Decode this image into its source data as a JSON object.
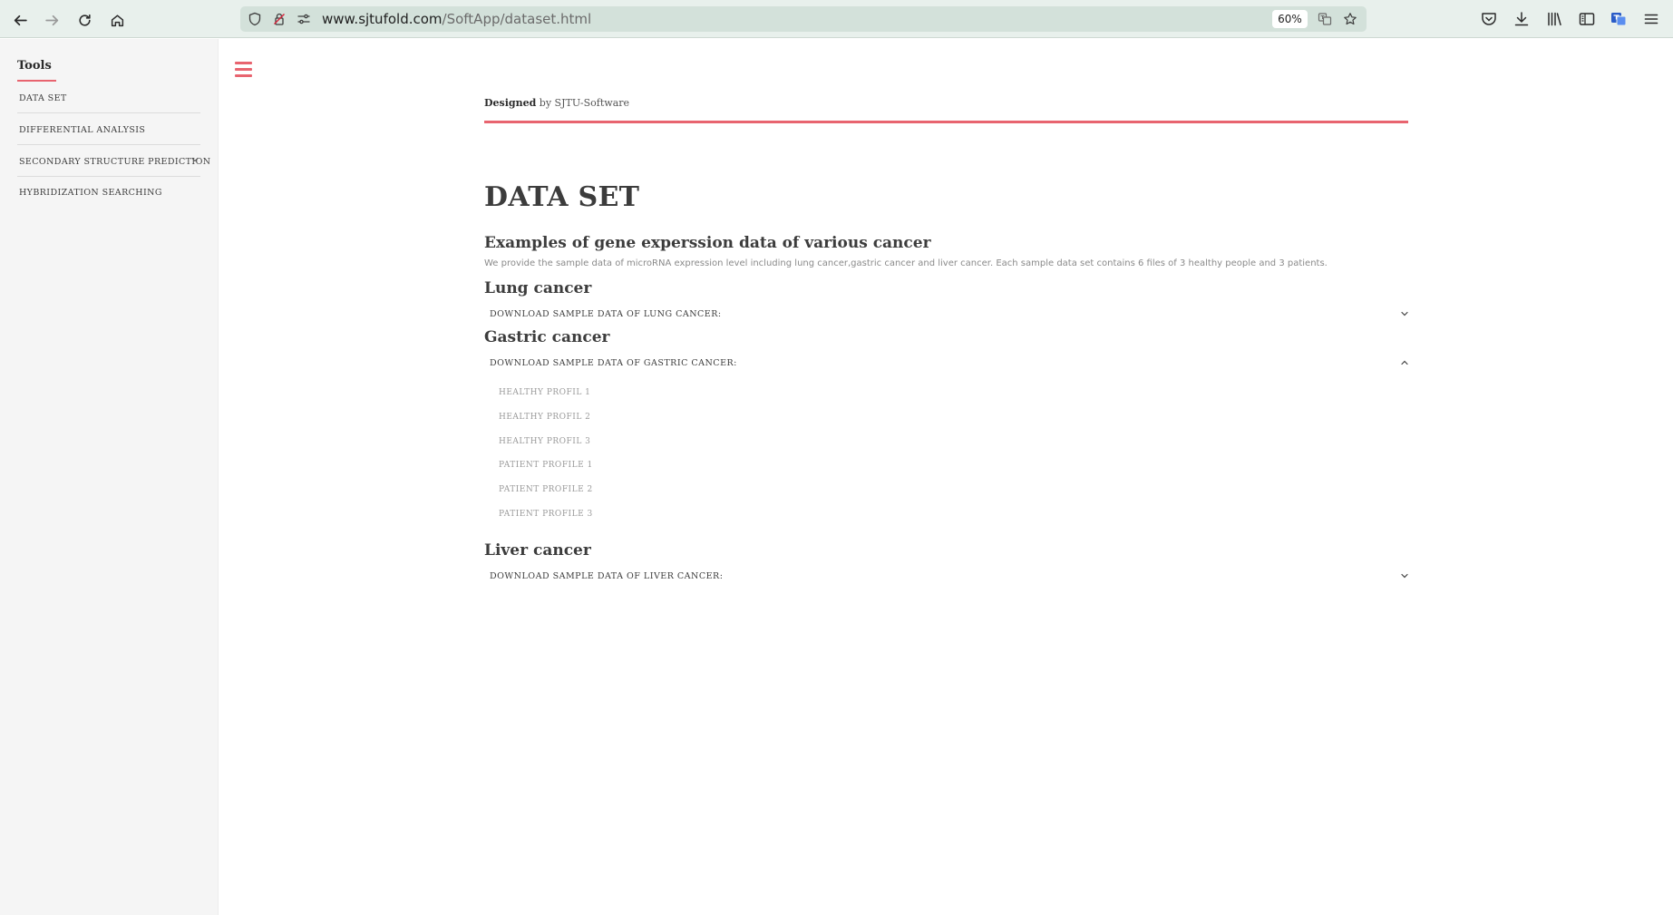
{
  "browser": {
    "url_host": "www.sjtufold.com",
    "url_path": "/SoftApp/dataset.html",
    "zoom": "60%"
  },
  "sidebar": {
    "title": "Tools",
    "items": [
      {
        "label": "DATA SET"
      },
      {
        "label": "DIFFERENTIAL ANALYSIS"
      },
      {
        "label": "SECONDARY STRUCTURE PREDICTION"
      },
      {
        "label": "HYBRIDIZATION SEARCHING"
      }
    ]
  },
  "header": {
    "designed_bold": "Designed",
    "designed_rest": "by SJTU-Software"
  },
  "main": {
    "title": "DATA SET",
    "subtitle": "Examples of gene experssion data of various cancer",
    "description": "We provide the sample data of microRNA expression level including lung cancer,gastric cancer and liver cancer. Each sample data set contains 6 files of 3 healthy people and 3 patients.",
    "sections": [
      {
        "heading": "Lung cancer",
        "download_label": "DOWNLOAD SAMPLE DATA OF LUNG CANCER:",
        "expanded": false
      },
      {
        "heading": "Gastric cancer",
        "download_label": "DOWNLOAD SAMPLE DATA OF GASTRIC CANCER:",
        "expanded": true,
        "files": [
          "HEALTHY PROFIL 1",
          "HEALTHY PROFIL 2",
          "HEALTHY PROFIL 3",
          "PATIENT PROFILE 1",
          "PATIENT PROFILE 2",
          "PATIENT PROFILE 3"
        ]
      },
      {
        "heading": "Liver cancer",
        "download_label": "DOWNLOAD SAMPLE DATA OF LIVER CANCER:",
        "expanded": false
      }
    ]
  },
  "colors": {
    "accent": "#e8646f",
    "chrome_bg": "#e8f0ec",
    "sidebar_bg": "#f5f5f5"
  }
}
